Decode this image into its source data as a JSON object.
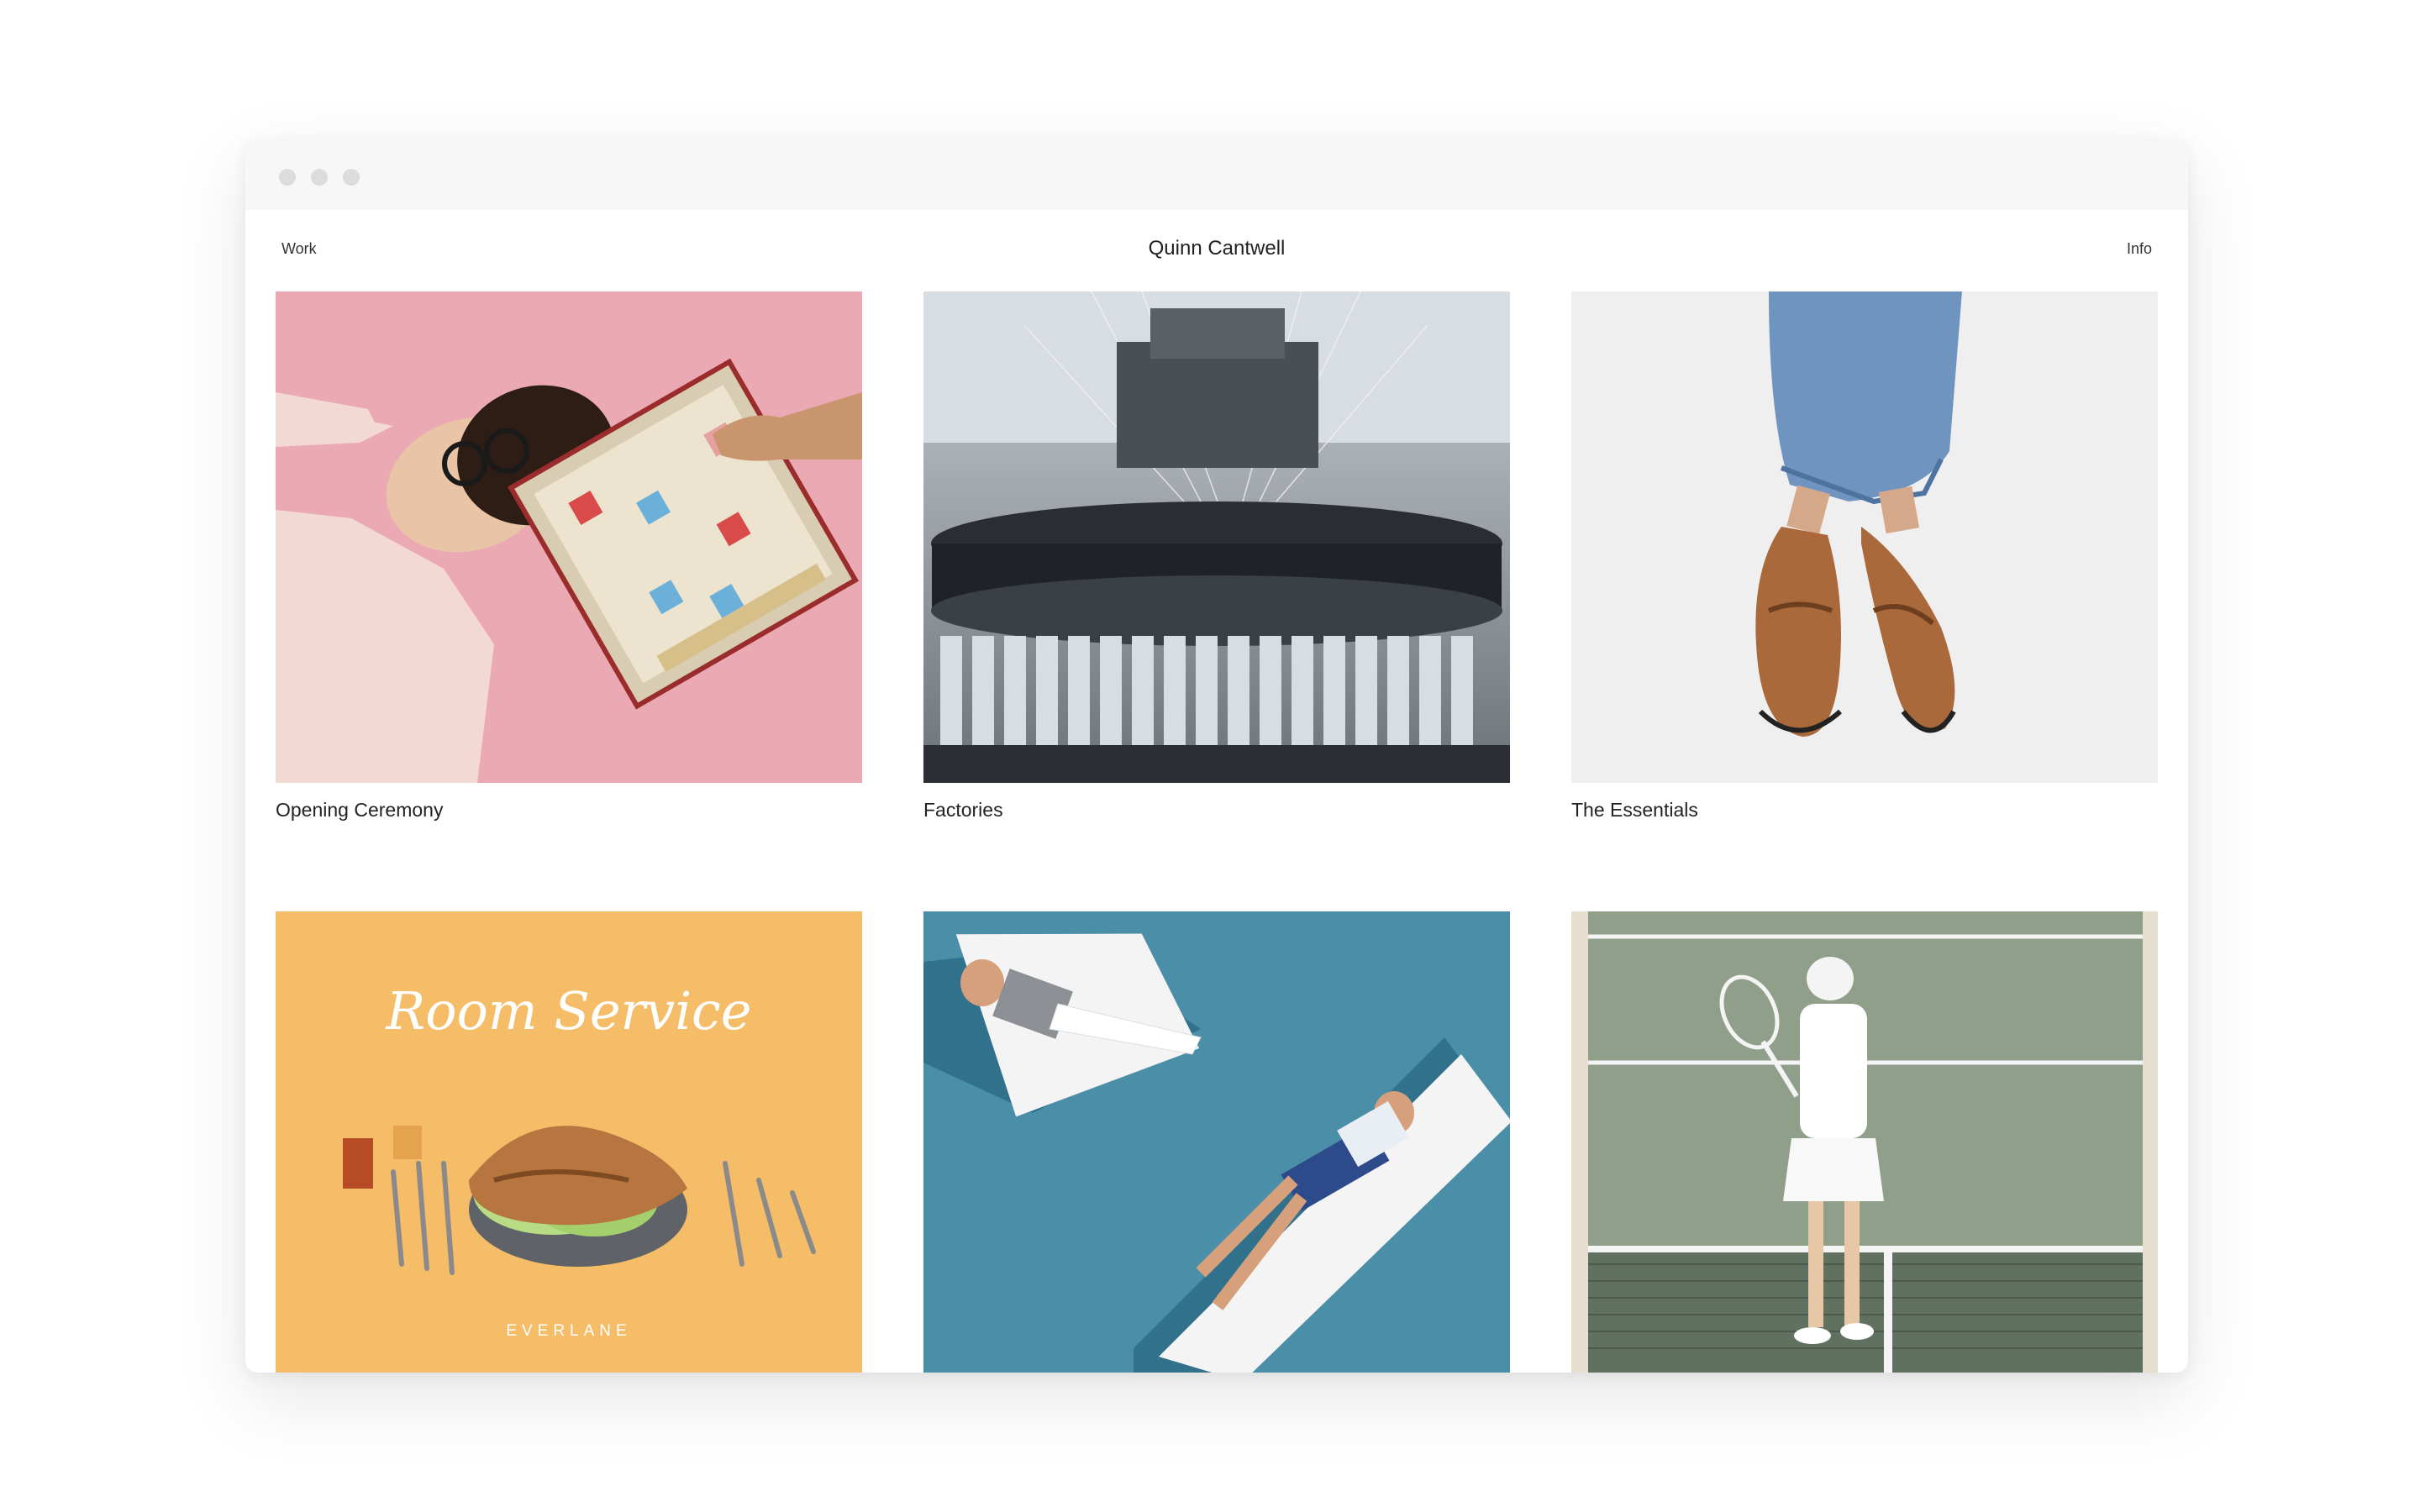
{
  "nav": {
    "work_label": "Work",
    "info_label": "Info",
    "site_title": "Quinn Cantwell"
  },
  "projects": [
    {
      "title": "Opening Ceremony",
      "image_icon": "scrabble-portrait-image"
    },
    {
      "title": "Factories",
      "image_icon": "knitting-machine-image"
    },
    {
      "title": "The Essentials",
      "image_icon": "loafers-image"
    },
    {
      "title": "",
      "image_icon": "room-service-poster-image",
      "poster_heading": "Room Service",
      "poster_brand": "EVERLANE"
    },
    {
      "title": "",
      "image_icon": "sunbathers-image"
    },
    {
      "title": "",
      "image_icon": "tennis-player-image"
    }
  ]
}
